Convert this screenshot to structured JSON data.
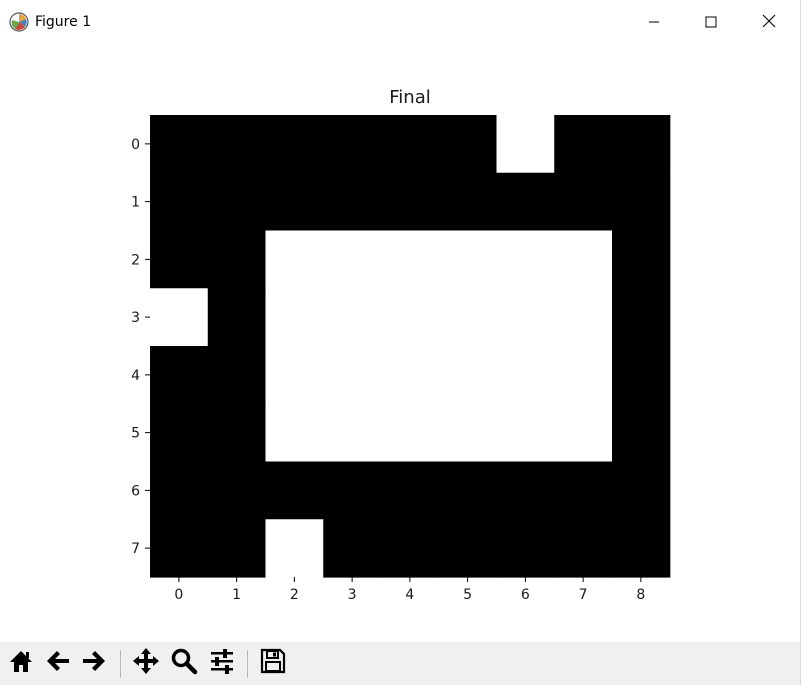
{
  "window": {
    "title": "Figure 1",
    "app_icon": "matplotlib-icon",
    "controls": [
      "minimize-icon",
      "maximize-icon",
      "close-icon"
    ]
  },
  "toolbar": {
    "buttons": [
      {
        "name": "home-button",
        "icon": "home-icon",
        "tooltip": ""
      },
      {
        "name": "back-button",
        "icon": "arrow-left-icon",
        "tooltip": ""
      },
      {
        "name": "forward-button",
        "icon": "arrow-right-icon",
        "tooltip": ""
      },
      {
        "name": "pan-button",
        "icon": "move-icon",
        "tooltip": ""
      },
      {
        "name": "zoom-button",
        "icon": "magnifier-icon",
        "tooltip": ""
      },
      {
        "name": "configure-subplots-button",
        "icon": "sliders-icon",
        "tooltip": ""
      },
      {
        "name": "save-button",
        "icon": "floppy-disk-icon",
        "tooltip": ""
      }
    ]
  },
  "chart_data": {
    "type": "heatmap",
    "title": "Final",
    "xlabel": "",
    "ylabel": "",
    "x_ticks": [
      "0",
      "1",
      "2",
      "3",
      "4",
      "5",
      "6",
      "7",
      "8"
    ],
    "y_ticks": [
      "0",
      "1",
      "2",
      "3",
      "4",
      "5",
      "6",
      "7"
    ],
    "colormap": "gray",
    "colors": {
      "zero": "#000000",
      "one": "#ffffff"
    },
    "grid": false,
    "values": [
      [
        0,
        0,
        0,
        0,
        0,
        0,
        1,
        0,
        0
      ],
      [
        0,
        0,
        0,
        0,
        0,
        0,
        0,
        0,
        0
      ],
      [
        0,
        0,
        1,
        1,
        1,
        1,
        1,
        1,
        0
      ],
      [
        1,
        0,
        1,
        1,
        1,
        1,
        1,
        1,
        0
      ],
      [
        0,
        0,
        1,
        1,
        1,
        1,
        1,
        1,
        0
      ],
      [
        0,
        0,
        1,
        1,
        1,
        1,
        1,
        1,
        0
      ],
      [
        0,
        0,
        0,
        0,
        0,
        0,
        0,
        0,
        0
      ],
      [
        0,
        0,
        1,
        0,
        0,
        0,
        0,
        0,
        0
      ]
    ]
  }
}
